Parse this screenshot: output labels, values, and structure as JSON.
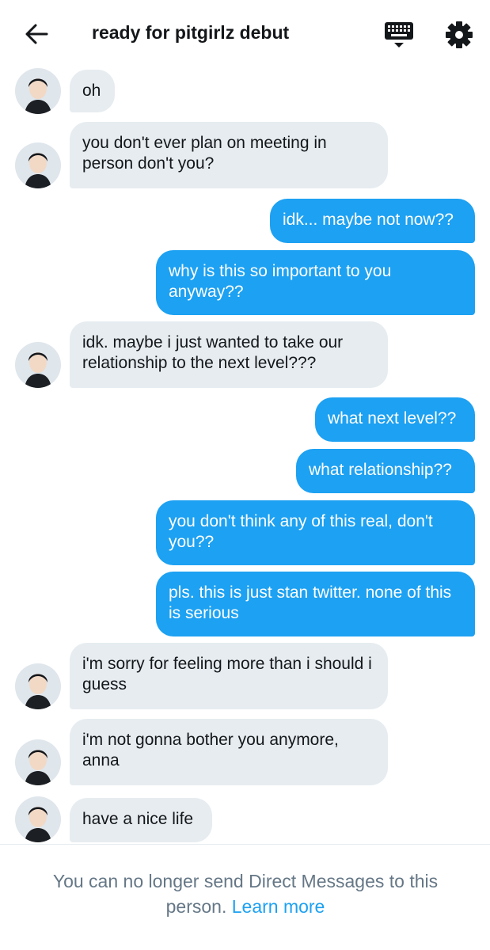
{
  "header": {
    "title": "ready for pitgirlz debut",
    "back_icon": "arrow-left-icon",
    "keyboard_icon": "keyboard-icon",
    "settings_icon": "gear-icon"
  },
  "messages": [
    {
      "dir": "in",
      "text": "oh"
    },
    {
      "dir": "in",
      "text": "you don't ever plan on meeting in person don't you?"
    },
    {
      "dir": "out",
      "text": "idk... maybe not now??"
    },
    {
      "dir": "out",
      "text": "why is this so important to you anyway??"
    },
    {
      "dir": "in",
      "text": "idk. maybe i just wanted to take our relationship to the next level???"
    },
    {
      "dir": "out",
      "text": "what next level??"
    },
    {
      "dir": "out",
      "text": "what relationship??"
    },
    {
      "dir": "out",
      "text": "you don't think any of this real, don't you??"
    },
    {
      "dir": "out",
      "text": "pls. this is just stan twitter. none of this is serious"
    },
    {
      "dir": "in",
      "text": "i'm sorry for feeling more than i should i guess"
    },
    {
      "dir": "in",
      "text": "i'm not gonna bother you anymore, anna"
    },
    {
      "dir": "in",
      "text": "have a nice life"
    }
  ],
  "footer": {
    "notice": "You can no longer send Direct Messages to this person.",
    "link": "Learn more"
  },
  "colors": {
    "accent": "#1da1f2",
    "incoming_bubble": "#e6ecf0",
    "muted_text": "#657786"
  }
}
